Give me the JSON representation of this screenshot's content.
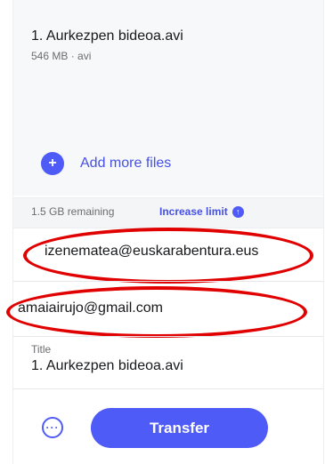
{
  "file": {
    "name": "1. Aurkezpen bideoa.avi",
    "meta": "546 MB · avi"
  },
  "add_files": {
    "icon": "plus-icon",
    "label": "Add more files"
  },
  "quota": {
    "remaining": "1.5 GB remaining",
    "increase_label": "Increase limit",
    "increase_icon": "arrow-up-circle-icon"
  },
  "emails": {
    "to": "izenematea@euskarabentura.eus",
    "from": "amaiairujo@gmail.com"
  },
  "title_field": {
    "label": "Title",
    "value": "1. Aurkezpen bideoa.avi"
  },
  "footer": {
    "more_icon": "more-options-icon",
    "transfer_label": "Transfer"
  },
  "colors": {
    "accent": "#4f5bf7",
    "annotation": "#e10000"
  }
}
